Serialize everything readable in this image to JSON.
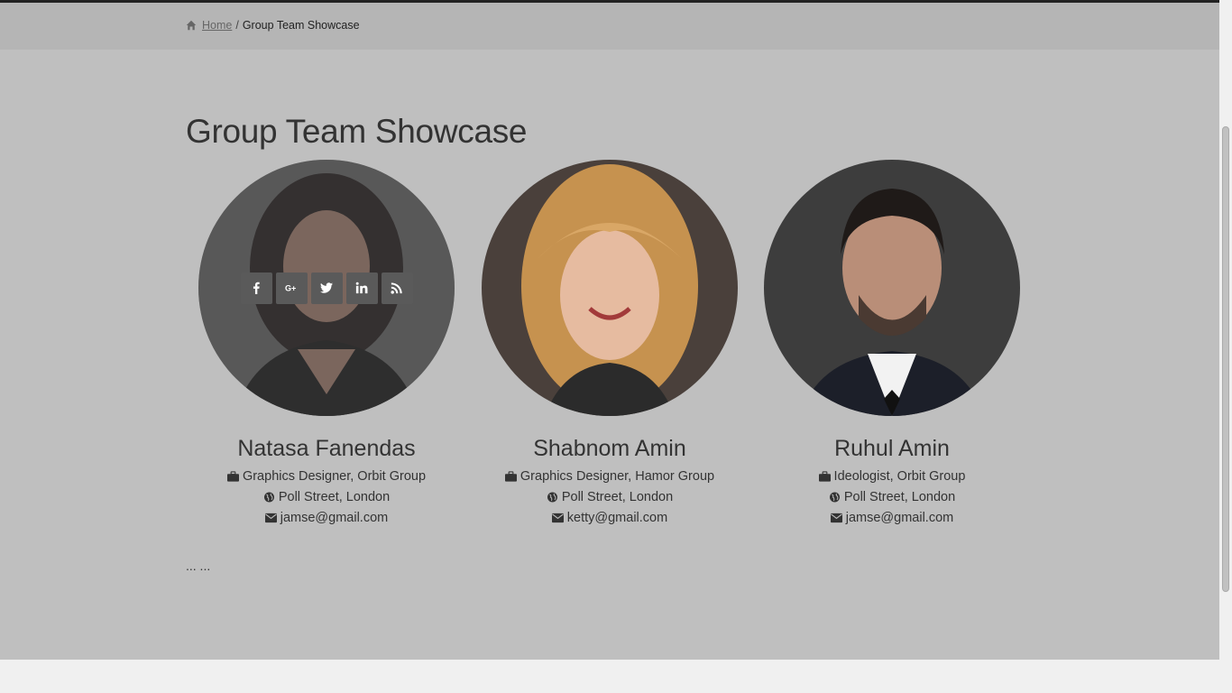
{
  "breadcrumb": {
    "home_icon": "home-icon",
    "home_label": "Home",
    "separator": "/",
    "current": "Group Team Showcase"
  },
  "page": {
    "title": "Group Team Showcase",
    "more_text": "... ..."
  },
  "members": [
    {
      "name": "Natasa Fanendas",
      "role": "Graphics Designer, Orbit Group",
      "location": "Poll Street, London",
      "email": "jamse@gmail.com",
      "hovered": true,
      "social": [
        "facebook-icon",
        "google-plus-icon",
        "twitter-icon",
        "linkedin-icon",
        "rss-icon"
      ]
    },
    {
      "name": "Shabnom Amin",
      "role": "Graphics Designer, Hamor Group",
      "location": "Poll Street, London",
      "email": "ketty@gmail.com",
      "hovered": false
    },
    {
      "name": "Ruhul Amin",
      "role": "Ideologist, Orbit Group",
      "location": "Poll Street, London",
      "email": "jamse@gmail.com",
      "hovered": false
    }
  ],
  "colors": {
    "page_bg": "#bfbfbf",
    "breadcrumb_bg": "#b5b5b5",
    "social_button_bg": "#5a5a5a",
    "text": "#333333"
  }
}
